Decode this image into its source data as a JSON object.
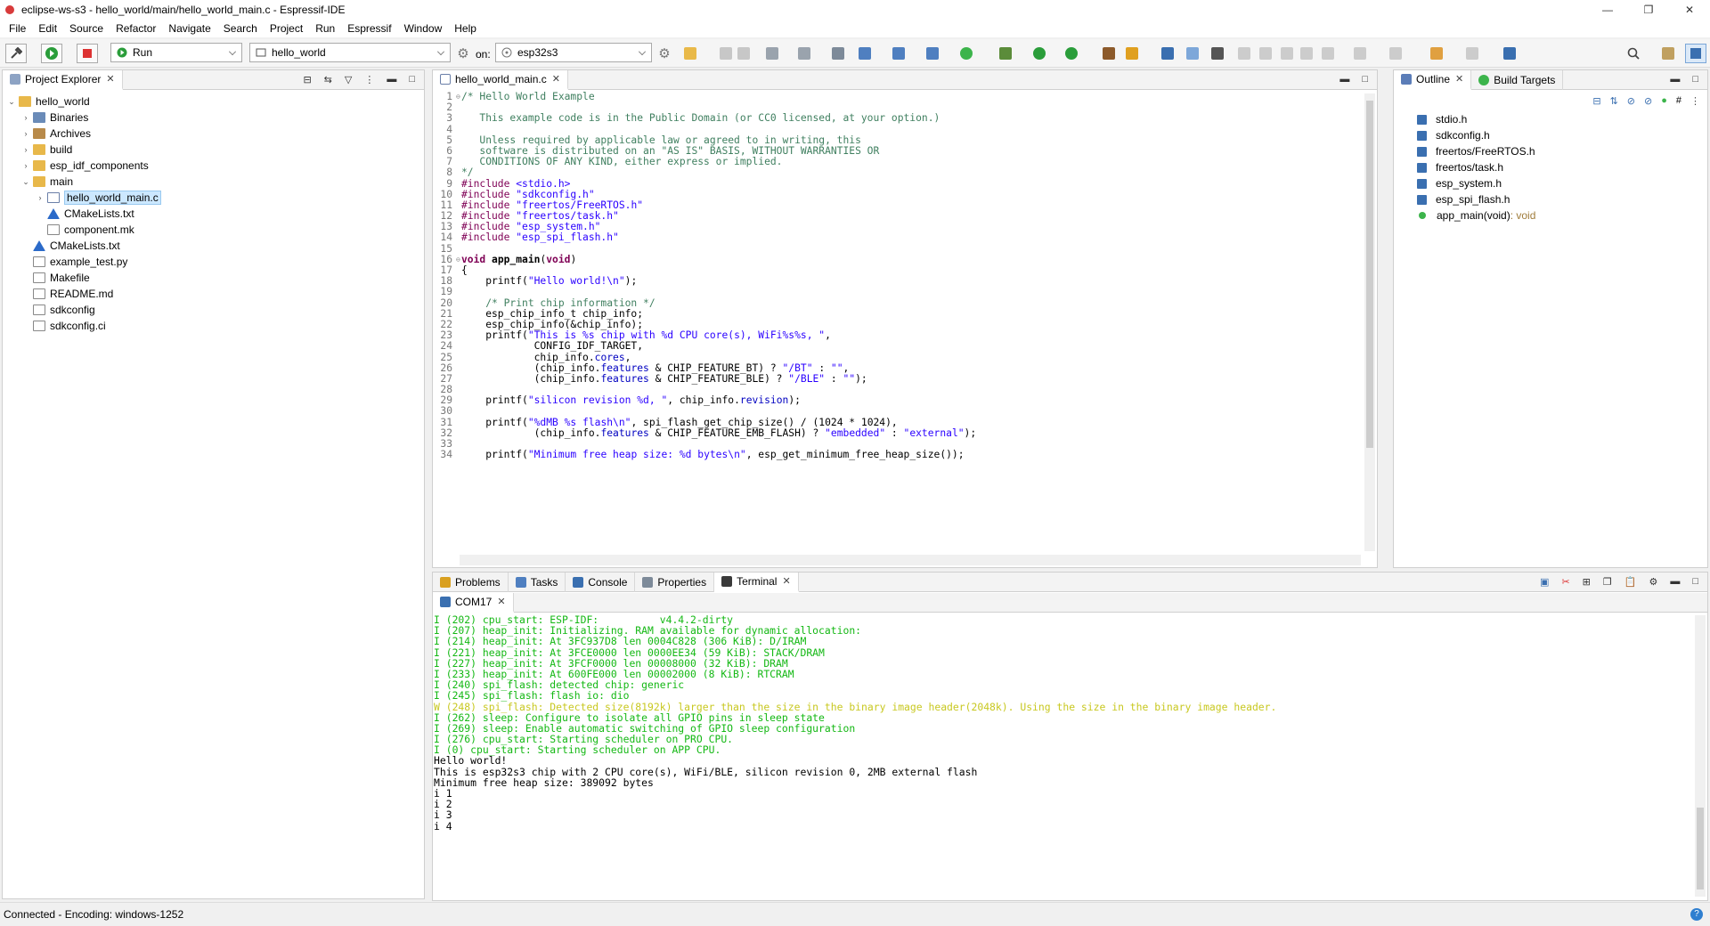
{
  "window": {
    "title": "eclipse-ws-s3 - hello_world/main/hello_world_main.c - Espressif-IDE",
    "controls": [
      "—",
      "❐",
      "✕"
    ]
  },
  "menu": [
    "File",
    "Edit",
    "Source",
    "Refactor",
    "Navigate",
    "Search",
    "Project",
    "Run",
    "Espressif",
    "Window",
    "Help"
  ],
  "toolbar": {
    "launch_mode": "Run",
    "launch_config": "hello_world",
    "on_label": "on:",
    "target": "esp32s3"
  },
  "project_explorer": {
    "tab_label": "Project Explorer",
    "items": [
      {
        "label": "hello_world",
        "depth": 0,
        "twisty": "⌄",
        "icon": "project-folder-icon"
      },
      {
        "label": "Binaries",
        "depth": 1,
        "twisty": "›",
        "icon": "binaries-icon"
      },
      {
        "label": "Archives",
        "depth": 1,
        "twisty": "›",
        "icon": "archives-icon"
      },
      {
        "label": "build",
        "depth": 1,
        "twisty": "›",
        "icon": "folder-icon"
      },
      {
        "label": "esp_idf_components",
        "depth": 1,
        "twisty": "›",
        "icon": "folder-icon"
      },
      {
        "label": "main",
        "depth": 1,
        "twisty": "⌄",
        "icon": "folder-icon"
      },
      {
        "label": "hello_world_main.c",
        "depth": 2,
        "twisty": "›",
        "icon": "c-file-icon",
        "selected": true
      },
      {
        "label": "CMakeLists.txt",
        "depth": 2,
        "twisty": "",
        "icon": "cmake-icon"
      },
      {
        "label": "component.mk",
        "depth": 2,
        "twisty": "",
        "icon": "file-icon"
      },
      {
        "label": "CMakeLists.txt",
        "depth": 1,
        "twisty": "",
        "icon": "cmake-icon"
      },
      {
        "label": "example_test.py",
        "depth": 1,
        "twisty": "",
        "icon": "file-icon"
      },
      {
        "label": "Makefile",
        "depth": 1,
        "twisty": "",
        "icon": "file-icon"
      },
      {
        "label": "README.md",
        "depth": 1,
        "twisty": "",
        "icon": "file-icon"
      },
      {
        "label": "sdkconfig",
        "depth": 1,
        "twisty": "",
        "icon": "file-icon"
      },
      {
        "label": "sdkconfig.ci",
        "depth": 1,
        "twisty": "",
        "icon": "file-icon"
      }
    ]
  },
  "editor": {
    "tab_label": "hello_world_main.c",
    "lines": [
      [
        {
          "t": "/* Hello World Example",
          "c": "cm"
        }
      ],
      [],
      [
        {
          "t": "   This example code is in the Public Domain (or CC0 licensed, at your option.)",
          "c": "cm"
        }
      ],
      [],
      [
        {
          "t": "   Unless required by applicable law or agreed to in writing, this",
          "c": "cm"
        }
      ],
      [
        {
          "t": "   software is distributed on an \"AS IS\" BASIS, WITHOUT WARRANTIES OR",
          "c": "cm"
        }
      ],
      [
        {
          "t": "   CONDITIONS OF ANY KIND, either express or implied.",
          "c": "cm"
        }
      ],
      [
        {
          "t": "*/",
          "c": "cm"
        }
      ],
      [
        {
          "t": "#include ",
          "c": "inc"
        },
        {
          "t": "<stdio.h>",
          "c": "str"
        }
      ],
      [
        {
          "t": "#include ",
          "c": "inc"
        },
        {
          "t": "\"sdkconfig.h\"",
          "c": "str"
        }
      ],
      [
        {
          "t": "#include ",
          "c": "inc"
        },
        {
          "t": "\"freertos/FreeRTOS.h\"",
          "c": "str"
        }
      ],
      [
        {
          "t": "#include ",
          "c": "inc"
        },
        {
          "t": "\"freertos/task.h\"",
          "c": "str"
        }
      ],
      [
        {
          "t": "#include ",
          "c": "inc"
        },
        {
          "t": "\"esp_system.h\"",
          "c": "str"
        }
      ],
      [
        {
          "t": "#include ",
          "c": "inc"
        },
        {
          "t": "\"esp_spi_flash.h\"",
          "c": "str"
        }
      ],
      [],
      [
        {
          "t": "void ",
          "c": "kw"
        },
        {
          "t": "app_main",
          "c": "fn"
        },
        {
          "t": "(",
          "c": "src"
        },
        {
          "t": "void",
          "c": "kw"
        },
        {
          "t": ")",
          "c": "src"
        }
      ],
      [
        {
          "t": "{",
          "c": "src"
        }
      ],
      [
        {
          "t": "    printf(",
          "c": "src"
        },
        {
          "t": "\"Hello world!\\n\"",
          "c": "str"
        },
        {
          "t": ");",
          "c": "src"
        }
      ],
      [],
      [
        {
          "t": "    /* Print chip information */",
          "c": "cm"
        }
      ],
      [
        {
          "t": "    esp_chip_info_t chip_info;",
          "c": "src"
        }
      ],
      [
        {
          "t": "    esp_chip_info(&chip_info);",
          "c": "src"
        }
      ],
      [
        {
          "t": "    printf(",
          "c": "src"
        },
        {
          "t": "\"This is %s chip with %d CPU core(s), WiFi%s%s, \"",
          "c": "str"
        },
        {
          "t": ",",
          "c": "src"
        }
      ],
      [
        {
          "t": "            CONFIG_IDF_TARGET,",
          "c": "src"
        }
      ],
      [
        {
          "t": "            chip_info.",
          "c": "src"
        },
        {
          "t": "cores",
          "c": "fld"
        },
        {
          "t": ",",
          "c": "src"
        }
      ],
      [
        {
          "t": "            (chip_info.",
          "c": "src"
        },
        {
          "t": "features",
          "c": "fld"
        },
        {
          "t": " & CHIP_FEATURE_BT) ? ",
          "c": "src"
        },
        {
          "t": "\"/BT\"",
          "c": "str"
        },
        {
          "t": " : ",
          "c": "src"
        },
        {
          "t": "\"\"",
          "c": "str"
        },
        {
          "t": ",",
          "c": "src"
        }
      ],
      [
        {
          "t": "            (chip_info.",
          "c": "src"
        },
        {
          "t": "features",
          "c": "fld"
        },
        {
          "t": " & CHIP_FEATURE_BLE) ? ",
          "c": "src"
        },
        {
          "t": "\"/BLE\"",
          "c": "str"
        },
        {
          "t": " : ",
          "c": "src"
        },
        {
          "t": "\"\"",
          "c": "str"
        },
        {
          "t": ");",
          "c": "src"
        }
      ],
      [],
      [
        {
          "t": "    printf(",
          "c": "src"
        },
        {
          "t": "\"silicon revision %d, \"",
          "c": "str"
        },
        {
          "t": ", chip_info.",
          "c": "src"
        },
        {
          "t": "revision",
          "c": "fld"
        },
        {
          "t": ");",
          "c": "src"
        }
      ],
      [],
      [
        {
          "t": "    printf(",
          "c": "src"
        },
        {
          "t": "\"%dMB %s flash\\n\"",
          "c": "str"
        },
        {
          "t": ", spi_flash_get_chip_size() / (1024 * 1024),",
          "c": "src"
        }
      ],
      [
        {
          "t": "            (chip_info.",
          "c": "src"
        },
        {
          "t": "features",
          "c": "fld"
        },
        {
          "t": " & CHIP_FEATURE_EMB_FLASH) ? ",
          "c": "src"
        },
        {
          "t": "\"embedded\"",
          "c": "str"
        },
        {
          "t": " : ",
          "c": "src"
        },
        {
          "t": "\"external\"",
          "c": "str"
        },
        {
          "t": ");",
          "c": "src"
        }
      ],
      [],
      [
        {
          "t": "    printf(",
          "c": "src"
        },
        {
          "t": "\"Minimum free heap size: %d bytes\\n\"",
          "c": "str"
        },
        {
          "t": ", esp_get_minimum_free_heap_size());",
          "c": "src"
        }
      ]
    ],
    "fold_lines": [
      1,
      16
    ]
  },
  "outline": {
    "tabs": [
      "Outline",
      "Build Targets"
    ],
    "items": [
      {
        "label": "stdio.h",
        "type": ""
      },
      {
        "label": "sdkconfig.h",
        "type": ""
      },
      {
        "label": "freertos/FreeRTOS.h",
        "type": ""
      },
      {
        "label": "freertos/task.h",
        "type": ""
      },
      {
        "label": "esp_system.h",
        "type": ""
      },
      {
        "label": "esp_spi_flash.h",
        "type": ""
      },
      {
        "label": "app_main(void)",
        "type": " : void",
        "func": true
      }
    ]
  },
  "bottom": {
    "tabs": [
      "Problems",
      "Tasks",
      "Console",
      "Properties",
      "Terminal"
    ],
    "active_tab": "Terminal",
    "terminal_tab": "COM17",
    "lines": [
      {
        "t": "I (202) cpu_start: ESP-IDF:          v4.4.2-dirty",
        "c": "g"
      },
      {
        "t": "I (207) heap_init: Initializing. RAM available for dynamic allocation:",
        "c": "g"
      },
      {
        "t": "I (214) heap_init: At 3FC937D8 len 0004C828 (306 KiB): D/IRAM",
        "c": "g"
      },
      {
        "t": "I (221) heap_init: At 3FCE0000 len 0000EE34 (59 KiB): STACK/DRAM",
        "c": "g"
      },
      {
        "t": "I (227) heap_init: At 3FCF0000 len 00008000 (32 KiB): DRAM",
        "c": "g"
      },
      {
        "t": "I (233) heap_init: At 600FE000 len 00002000 (8 KiB): RTCRAM",
        "c": "g"
      },
      {
        "t": "I (240) spi_flash: detected chip: generic",
        "c": "g"
      },
      {
        "t": "I (245) spi_flash: flash io: dio",
        "c": "g"
      },
      {
        "t": "W (248) spi_flash: Detected size(8192k) larger than the size in the binary image header(2048k). Using the size in the binary image header.",
        "c": "y"
      },
      {
        "t": "I (262) sleep: Configure to isolate all GPIO pins in sleep state",
        "c": "g"
      },
      {
        "t": "I (269) sleep: Enable automatic switching of GPIO sleep configuration",
        "c": "g"
      },
      {
        "t": "I (276) cpu_start: Starting scheduler on PRO CPU.",
        "c": "g"
      },
      {
        "t": "I (0) cpu_start: Starting scheduler on APP CPU.",
        "c": "g"
      },
      {
        "t": "Hello world!",
        "c": "k"
      },
      {
        "t": "This is esp32s3 chip with 2 CPU core(s), WiFi/BLE, silicon revision 0, 2MB external flash",
        "c": "k"
      },
      {
        "t": "Minimum free heap size: 389092 bytes",
        "c": "k"
      },
      {
        "t": "i 1",
        "c": "k"
      },
      {
        "t": "i 2",
        "c": "k"
      },
      {
        "t": "i 3",
        "c": "k"
      },
      {
        "t": "i 4",
        "c": "k"
      }
    ]
  },
  "status": {
    "text": "Connected - Encoding: windows-1252"
  }
}
